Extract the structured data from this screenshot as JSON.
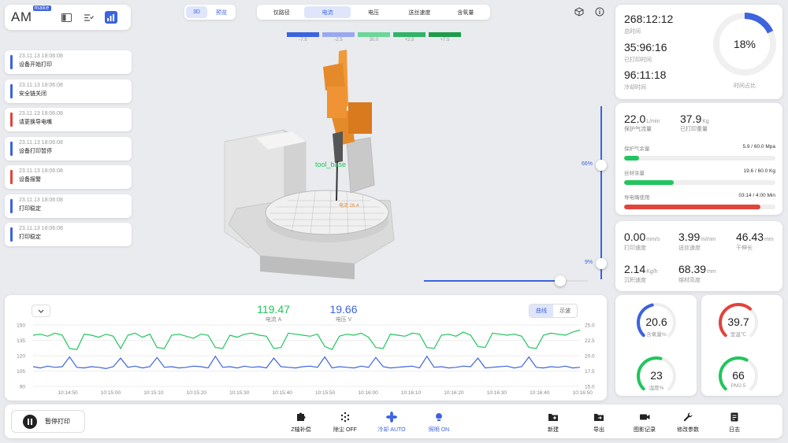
{
  "brand": {
    "name": "AM",
    "badge": "make"
  },
  "view_toggle": [
    "3D",
    "预览"
  ],
  "view_active": 0,
  "layer_tabs": [
    "仅路径",
    "电流",
    "电压",
    "送丝速度",
    "含氧量"
  ],
  "layer_active": 1,
  "color_legend": [
    {
      "label": "-7.5",
      "color": "#3d63dd"
    },
    {
      "label": "-2.5",
      "color": "#99a9ef"
    },
    {
      "label": "30.0",
      "color": "#6cd69a"
    },
    {
      "label": "+2.5",
      "color": "#2fb468"
    },
    {
      "label": "+7.5",
      "color": "#1e9c4a"
    }
  ],
  "events": [
    {
      "time": "23.11.13  18:06:08",
      "message": "设备开始打印",
      "color": "#3d63dd"
    },
    {
      "time": "23.11.13  18:06:08",
      "message": "安全链关闭",
      "color": "#3d63dd"
    },
    {
      "time": "23.11.13  18:06:08",
      "message": "请更换导电嘴",
      "color": "#e2433a"
    },
    {
      "time": "23.11.13  18:06:08",
      "message": "设备打印暂停",
      "color": "#3d63dd"
    },
    {
      "time": "23.11.13  18:06:08",
      "message": "设备报警",
      "color": "#e2433a"
    },
    {
      "time": "23.11.13  18:06:08",
      "message": "打印稳定",
      "color": "#3d63dd"
    },
    {
      "time": "23.11.13  18:06:08",
      "message": "打印稳定",
      "color": "#3d63dd"
    }
  ],
  "scene": {
    "tool_label": "tool_base",
    "current_label": "电流 26.4",
    "slider_top_label": "66%",
    "slider_bottom_label": "9%",
    "slider_top_value": 0.66,
    "slider_bottom_value": 0.09,
    "horizontal_slider_value": 0.83
  },
  "time_card": {
    "total_time": "268:12:12",
    "total_label": "总时间",
    "printed_time": "35:96:16",
    "printed_label": "已打印时间",
    "cool_time": "96:11:18",
    "cool_label": "冷却时间",
    "ratio": "18%",
    "ratio_value": 0.18,
    "ratio_label": "时间占比"
  },
  "material": {
    "gas_flow": "22.0",
    "gas_flow_unit": "L/min",
    "gas_flow_label": "保护气流量",
    "printed_weight": "37.9",
    "printed_weight_unit": "Kg",
    "printed_weight_label": "已打印重量",
    "bars": [
      {
        "label": "保护气余量",
        "value": "5.9 / 60.0 Mpa",
        "fraction": 0.098,
        "color": "#22c55e"
      },
      {
        "label": "丝材余量",
        "value": "19.6 / 60.0 Kg",
        "fraction": 0.327,
        "color": "#22c55e"
      },
      {
        "label": "导电嘴使用",
        "value": "03:14 / 4:00 Min",
        "fraction": 0.9,
        "color": "#e2433a"
      }
    ]
  },
  "speeds": [
    {
      "value": "0.00",
      "unit": "mm/s",
      "label": "打印速度"
    },
    {
      "value": "3.99",
      "unit": "m/min",
      "label": "送丝速度"
    },
    {
      "value": "46.43",
      "unit": "mm",
      "label": "干伸长"
    },
    {
      "value": "2.14",
      "unit": "Kg/h",
      "label": "沉积速度"
    },
    {
      "value": "68.39",
      "unit": "mm",
      "label": "熔材高度"
    }
  ],
  "gauges": [
    {
      "value": "20.6",
      "label": "含氧量%",
      "fraction": 0.45,
      "color": "#3d63dd"
    },
    {
      "value": "39.7",
      "label": "室温℃",
      "fraction": 0.65,
      "color": "#e2433a"
    },
    {
      "value": "23",
      "label": "湿度%",
      "fraction": 0.55,
      "color": "#22c55e"
    },
    {
      "value": "66",
      "label": "PM2.5",
      "fraction": 0.6,
      "color": "#22c55e"
    }
  ],
  "chart_readout": {
    "current_value": "119.47",
    "current_label": "电流 A",
    "voltage_value": "19.66",
    "voltage_label": "电压 V"
  },
  "chart_mode": [
    "曲线",
    "示波"
  ],
  "chart_mode_active": 0,
  "chart_data": {
    "type": "line",
    "x": [
      "10:14:50",
      "10:15:00",
      "10:15:10",
      "10:15:20",
      "10:15:30",
      "10:15:40",
      "10:15:50",
      "10:16:00",
      "10:16:10",
      "10:16:20",
      "10:16:30",
      "10:16:40",
      "10:16:50"
    ],
    "left_axis": {
      "ticks": [
        150,
        135,
        120,
        105,
        90
      ],
      "ylim": [
        90,
        150
      ]
    },
    "right_axis": {
      "ticks": [
        25.0,
        22.5,
        20.0,
        17.5,
        15.0
      ],
      "ylim": [
        15,
        25
      ]
    },
    "series": [
      {
        "axis": "left",
        "color": "#22c55e",
        "values": [
          140,
          141,
          139,
          142,
          140,
          127,
          126,
          141,
          140,
          138,
          141,
          139,
          127,
          140,
          142,
          138,
          141,
          128,
          127,
          140,
          141,
          139,
          137,
          141,
          140,
          128,
          127,
          140,
          138,
          141,
          142,
          140,
          139,
          127,
          128,
          142,
          141,
          140,
          139,
          141,
          129,
          126,
          139,
          141,
          140,
          142,
          138,
          128,
          127,
          141,
          140,
          139,
          142,
          141,
          128,
          127,
          140,
          141,
          139,
          143,
          140,
          129,
          128,
          142,
          141,
          140,
          141,
          139,
          128,
          127,
          140,
          142,
          141,
          140,
          143,
          145
        ]
      },
      {
        "axis": "right",
        "color": "#3d63dd",
        "values": [
          18.2,
          18.0,
          18.3,
          18.1,
          18.2,
          19.8,
          18.1,
          18.0,
          18.2,
          18.1,
          17.9,
          18.2,
          19.6,
          18.1,
          18.3,
          18.0,
          18.2,
          19.7,
          18.1,
          18.2,
          18.0,
          18.1,
          18.3,
          18.2,
          18.0,
          19.9,
          18.1,
          18.2,
          18.0,
          18.3,
          18.1,
          18.2,
          18.0,
          19.6,
          18.2,
          18.1,
          18.0,
          18.2,
          18.3,
          18.1,
          19.8,
          18.0,
          18.2,
          18.1,
          18.0,
          18.3,
          18.1,
          19.7,
          18.2,
          18.0,
          18.1,
          18.2,
          18.3,
          18.0,
          19.9,
          18.1,
          18.2,
          18.0,
          18.1,
          18.3,
          18.2,
          19.6,
          18.0,
          18.1,
          18.2,
          18.3,
          18.0,
          18.2,
          19.8,
          18.1,
          18.0,
          18.2,
          18.1,
          18.3,
          18.0,
          18.1
        ]
      }
    ]
  },
  "toolbar": {
    "pause_label": "暂停打印",
    "tools": [
      {
        "label": "Z轴补偿",
        "icon": "puzzle-icon",
        "active": false
      },
      {
        "label": "除尘 OFF",
        "icon": "dust-icon",
        "active": false
      },
      {
        "label": "冷却 AUTO",
        "icon": "fan-icon",
        "active": true
      },
      {
        "label": "照明 ON",
        "icon": "light-icon",
        "active": true
      },
      {
        "label": "新建",
        "icon": "new-folder-icon",
        "active": false
      },
      {
        "label": "导出",
        "icon": "export-folder-icon",
        "active": false
      },
      {
        "label": "图影记录",
        "icon": "video-icon",
        "active": false
      },
      {
        "label": "修改参数",
        "icon": "wrench-icon",
        "active": false
      },
      {
        "label": "日志",
        "icon": "log-icon",
        "active": false
      }
    ]
  }
}
